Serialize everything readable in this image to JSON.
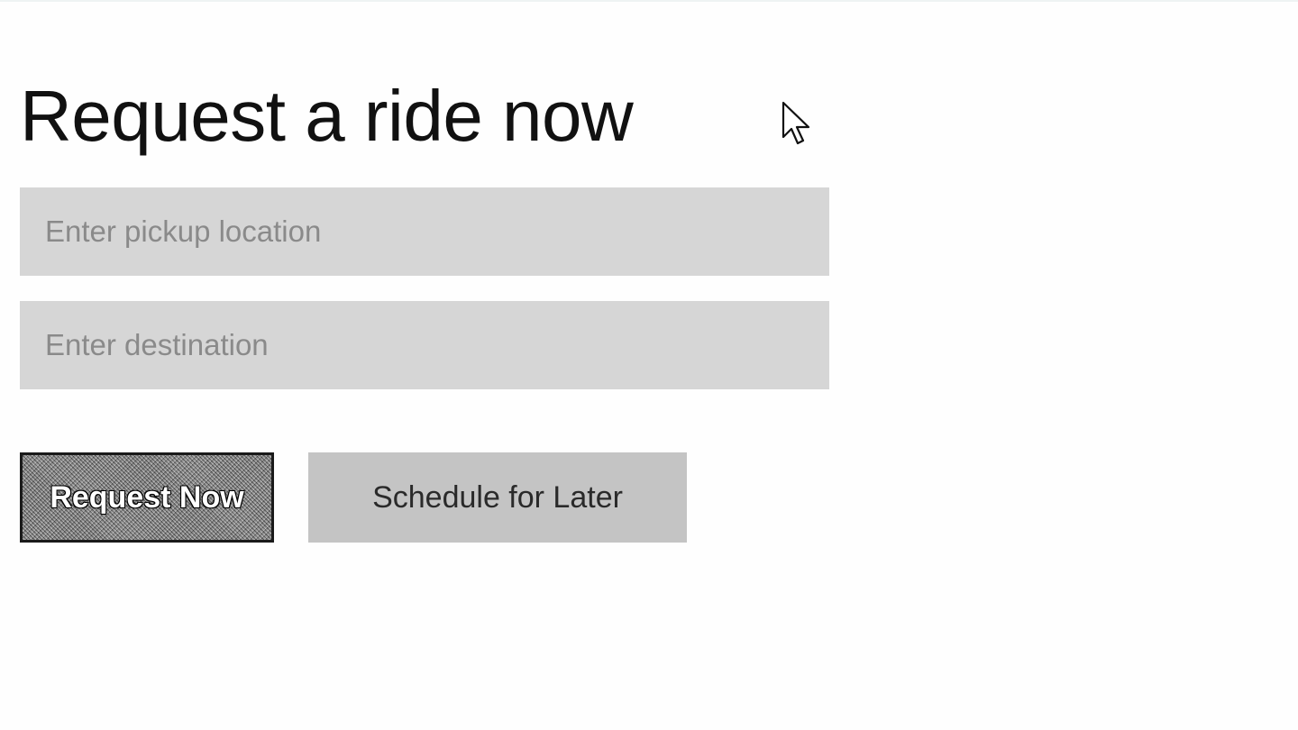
{
  "form": {
    "title": "Request a ride now",
    "pickup_placeholder": "Enter pickup location",
    "pickup_value": "",
    "destination_placeholder": "Enter destination",
    "destination_value": "",
    "request_label": "Request Now",
    "schedule_label": "Schedule for Later"
  },
  "icons": {
    "cursor": "mouse-pointer-icon"
  },
  "colors": {
    "field_background": "#d6d6d6",
    "schedule_button_background": "#c4c4c4",
    "request_button_border": "#1a1a1a"
  }
}
